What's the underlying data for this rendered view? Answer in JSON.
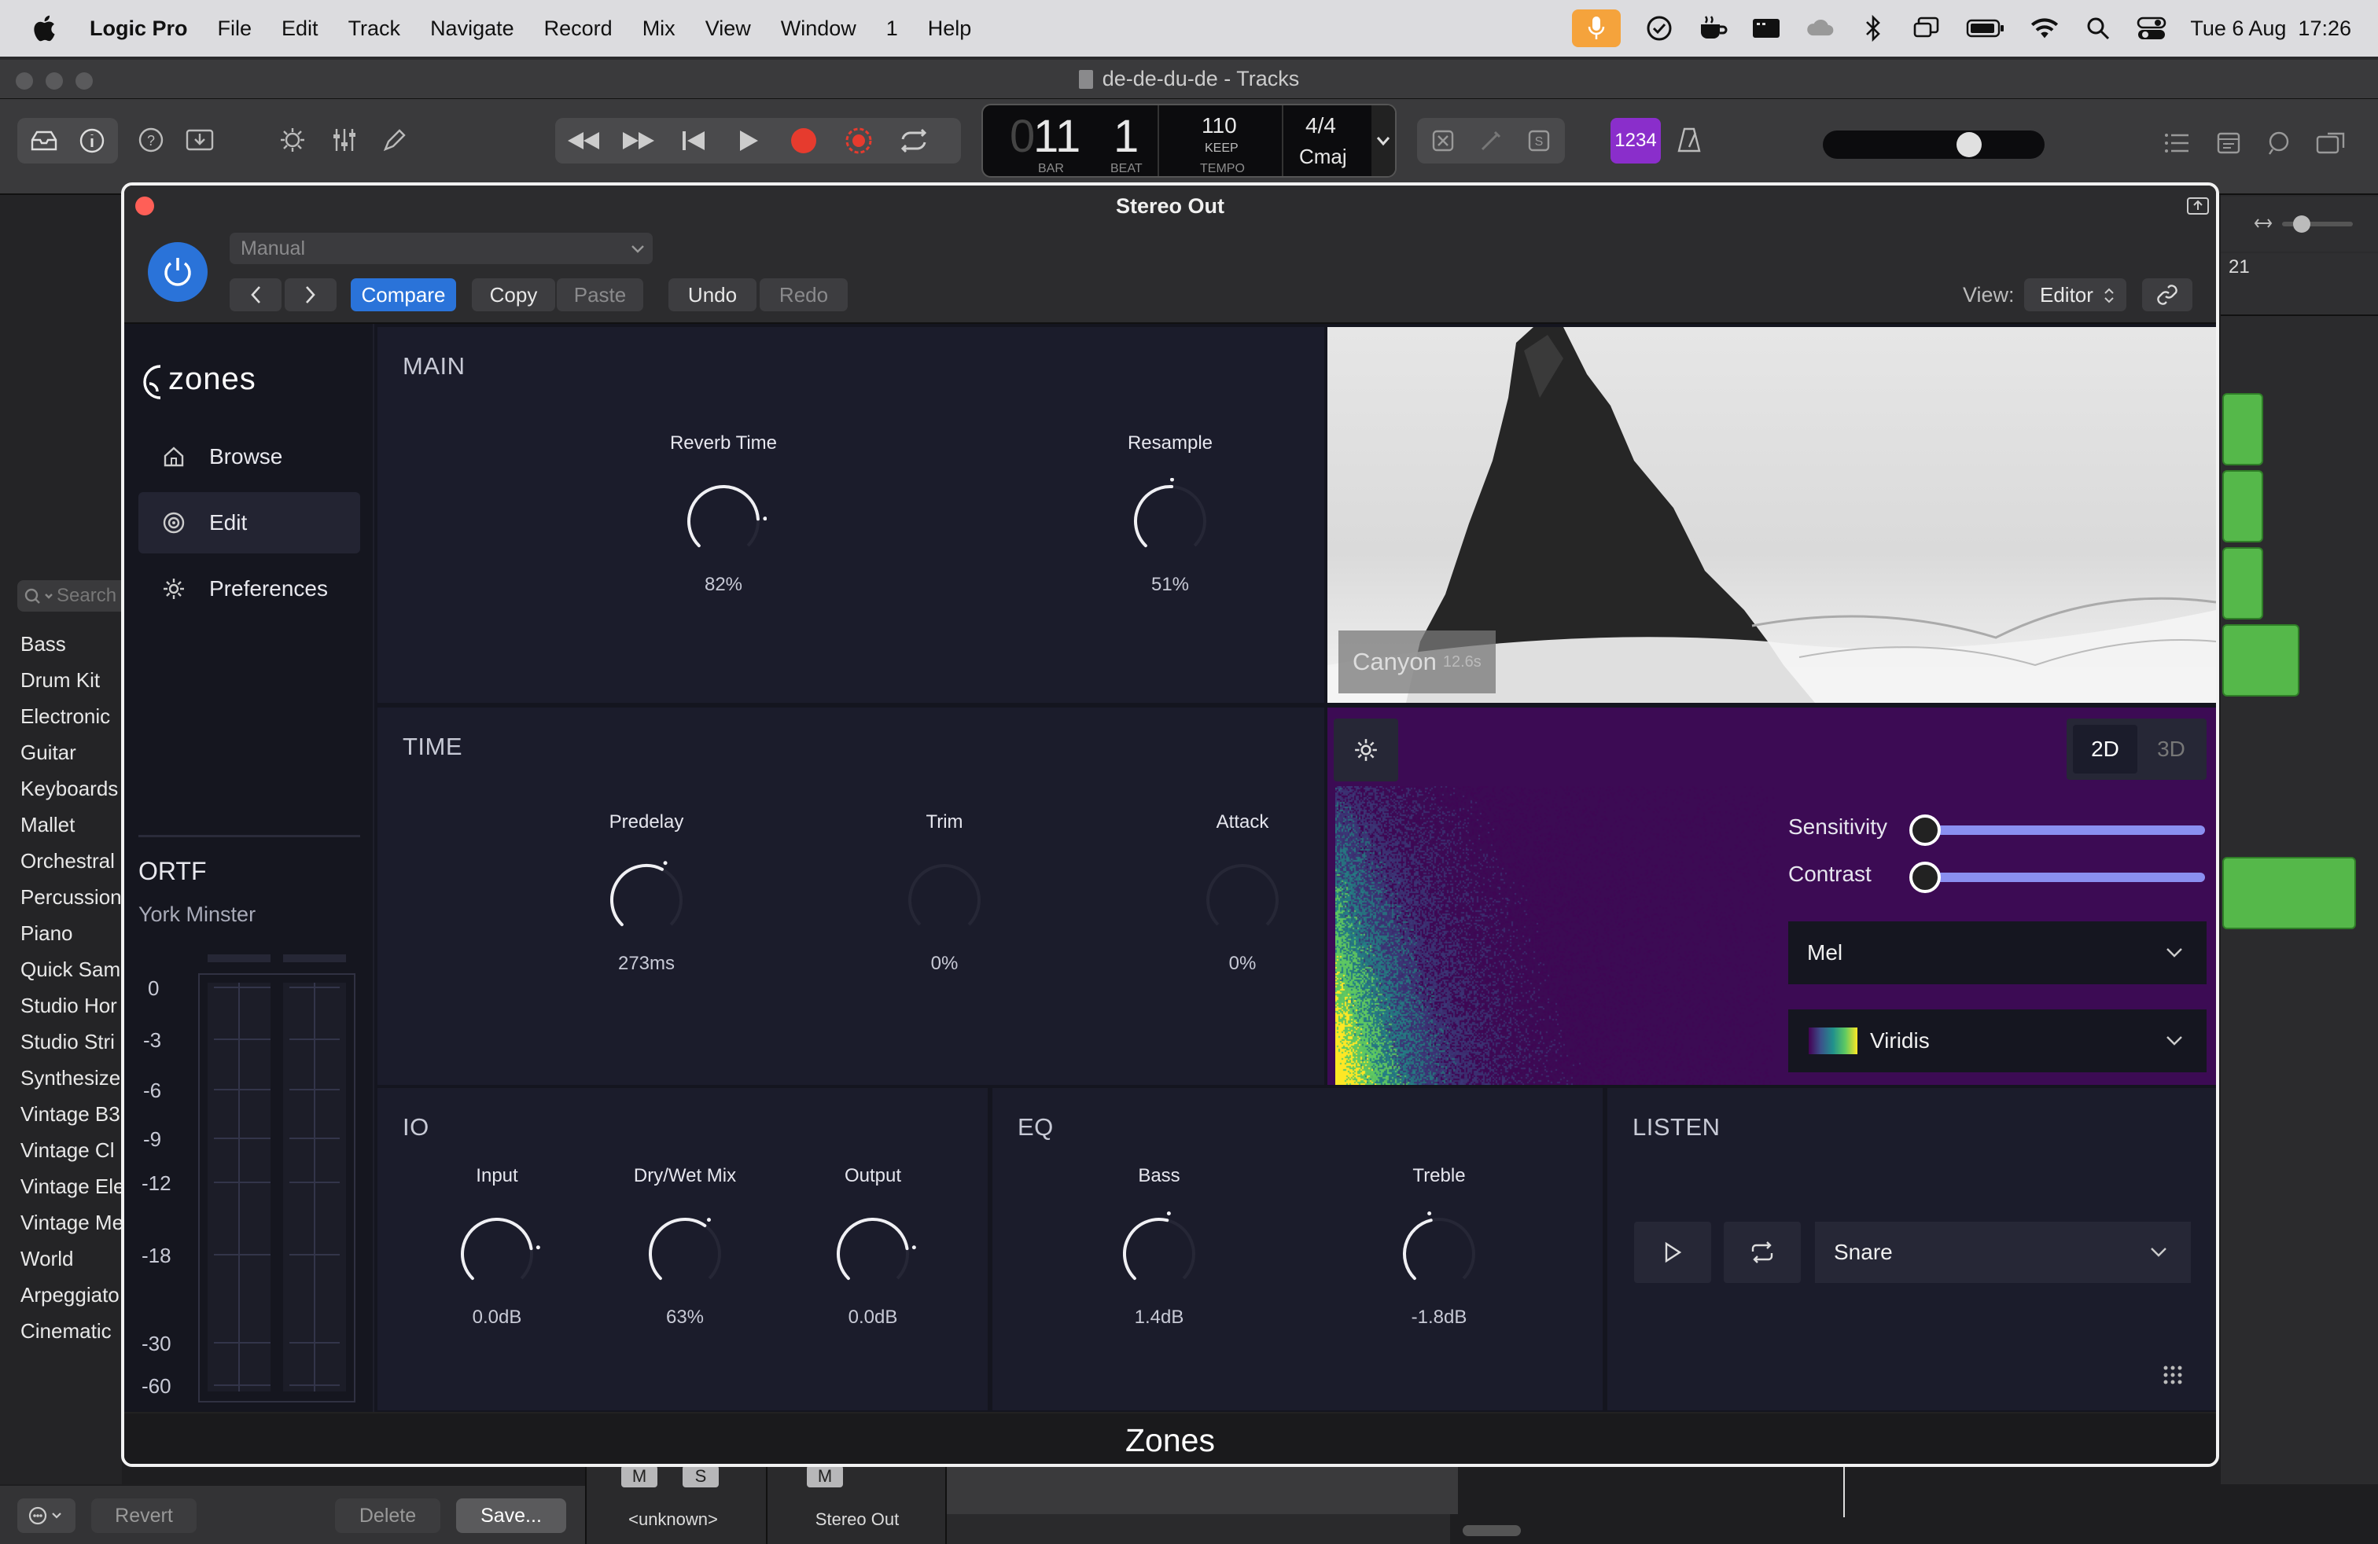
{
  "menubar": {
    "app": "Logic Pro",
    "items": [
      "File",
      "Edit",
      "Track",
      "Navigate",
      "Record",
      "Mix",
      "View",
      "Window",
      "1",
      "Help"
    ],
    "datetime": "Tue 6 Aug  17:26"
  },
  "window": {
    "title": "de-de-du-de - Tracks"
  },
  "lcd": {
    "bar": "11",
    "beat": "1",
    "bar_label": "BAR",
    "beat_label": "BEAT",
    "tempo": "110",
    "tempo_mode": "KEEP",
    "tempo_label": "TEMPO",
    "signature": "4/4",
    "key": "Cmaj"
  },
  "toolbar": {
    "count_in": "1234"
  },
  "library": {
    "search_placeholder": "Search",
    "items": [
      "Bass",
      "Drum Kit",
      "Electronic",
      "Guitar",
      "Keyboards",
      "Mallet",
      "Orchestral",
      "Percussion",
      "Piano",
      "Quick Sam",
      "Studio Hor",
      "Studio Stri",
      "Synthesize",
      "Vintage B3",
      "Vintage Cl",
      "Vintage Ele",
      "Vintage Me",
      "World",
      "Arpeggiato",
      "Cinematic"
    ],
    "footer": {
      "revert": "Revert",
      "delete": "Delete",
      "save": "Save..."
    }
  },
  "mixer_strip": {
    "m1": "M",
    "s1": "S",
    "name1": "<unknown>",
    "m2": "M",
    "name2": "Stereo Out"
  },
  "tracks": {
    "ruler_num": "21"
  },
  "plugin": {
    "title": "Stereo Out",
    "preset": "Manual",
    "buttons": {
      "compare": "Compare",
      "copy": "Copy",
      "paste": "Paste",
      "undo": "Undo",
      "redo": "Redo"
    },
    "view_label": "View:",
    "view_value": "Editor",
    "footer": "Zones"
  },
  "zones": {
    "logo": "zones",
    "nav": [
      {
        "label": "Browse"
      },
      {
        "label": "Edit"
      },
      {
        "label": "Preferences"
      }
    ],
    "ir": {
      "mic": "ORTF",
      "location": "York Minster"
    },
    "meter_scale": [
      "0",
      "-3",
      "-6",
      "-9",
      "-12",
      "-18",
      "-30",
      "-60"
    ],
    "main": {
      "title": "MAIN",
      "knobs": [
        {
          "label": "Reverb Time",
          "value": "82%",
          "level": 0.82
        },
        {
          "label": "Resample",
          "value": "51%",
          "level": 0.51
        }
      ]
    },
    "time": {
      "title": "TIME",
      "knobs": [
        {
          "label": "Predelay",
          "value": "273ms",
          "level": 0.6
        },
        {
          "label": "Trim",
          "value": "0%",
          "level": 0
        },
        {
          "label": "Attack",
          "value": "0%",
          "level": 0
        }
      ]
    },
    "io": {
      "title": "IO",
      "knobs": [
        {
          "label": "Input",
          "value": "0.0dB",
          "level": 0.8
        },
        {
          "label": "Dry/Wet Mix",
          "value": "63%",
          "level": 0.63
        },
        {
          "label": "Output",
          "value": "0.0dB",
          "level": 0.8
        }
      ]
    },
    "eq": {
      "title": "EQ",
      "knobs": [
        {
          "label": "Bass",
          "value": "1.4dB",
          "level": 0.55
        },
        {
          "label": "Treble",
          "value": "-1.8dB",
          "level": 0.45
        }
      ]
    },
    "listen": {
      "title": "LISTEN",
      "sample": "Snare"
    },
    "image": {
      "name": "Canyon",
      "duration": "12.6s"
    },
    "spectrogram": {
      "mode_2d": "2D",
      "mode_3d": "3D",
      "sensitivity_label": "Sensitivity",
      "sensitivity": 0,
      "contrast_label": "Contrast",
      "contrast": 0,
      "scale": "Mel",
      "colormap": "Viridis"
    }
  }
}
